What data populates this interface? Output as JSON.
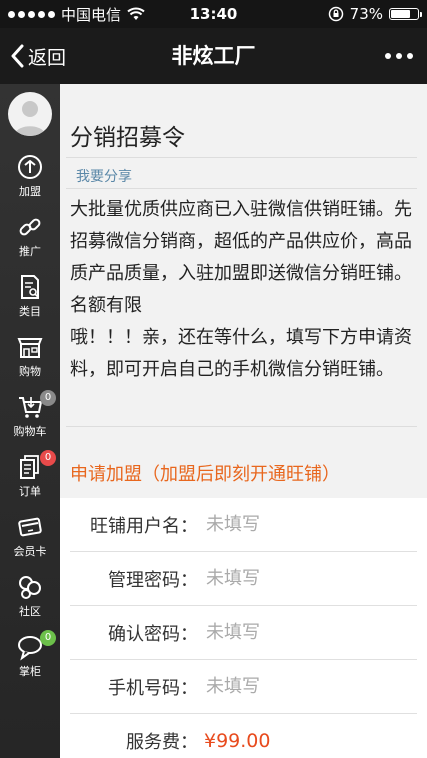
{
  "status_bar": {
    "carrier": "中国电信",
    "time": "13:40",
    "battery": "73%",
    "battery_level": 0.73
  },
  "nav": {
    "back_label": "返回",
    "title": "非炫工厂"
  },
  "sidebar": {
    "items": [
      {
        "label": "加盟",
        "icon": "plus-circle-icon"
      },
      {
        "label": "推广",
        "icon": "link-icon"
      },
      {
        "label": "类目",
        "icon": "catalog-icon"
      },
      {
        "label": "购物",
        "icon": "shop-icon"
      },
      {
        "label": "购物车",
        "icon": "cart-icon",
        "badge": "0",
        "badge_color": "#8a8a8a"
      },
      {
        "label": "订单",
        "icon": "order-icon",
        "badge": "0",
        "badge_color": "#e84a4a"
      },
      {
        "label": "会员卡",
        "icon": "card-icon"
      },
      {
        "label": "社区",
        "icon": "community-icon"
      },
      {
        "label": "掌柜",
        "icon": "chat-icon",
        "badge": "0",
        "badge_color": "#6cc04a"
      }
    ]
  },
  "content": {
    "title": "分销招募令",
    "share_label": "我要分享",
    "body_lines": [
      "大批量优质供应商已入驻微信供销旺铺。先招募微信分销商，超低的产品供应价，高品质产品质量，入驻加盟即送微信分销旺铺。名额有限",
      "哦！！！亲，还在等什么，填写下方申请资料，即可开启自己的手机微信分销旺铺。"
    ],
    "apply_title": "申请加盟（加盟后即刻开通旺铺）"
  },
  "form": {
    "shop_username": {
      "label": "旺铺用户名：",
      "placeholder": "未填写"
    },
    "password": {
      "label": "管理密码：",
      "placeholder": "未填写"
    },
    "confirm_password": {
      "label": "确认密码：",
      "placeholder": "未填写"
    },
    "phone": {
      "label": "手机号码：",
      "placeholder": "未填写"
    },
    "service_fee": {
      "label": "服务费：",
      "value": "¥99.00"
    }
  },
  "colors": {
    "accent_orange": "#e8671e",
    "price_red": "#e84b1e",
    "link_blue": "#5b88a8"
  }
}
